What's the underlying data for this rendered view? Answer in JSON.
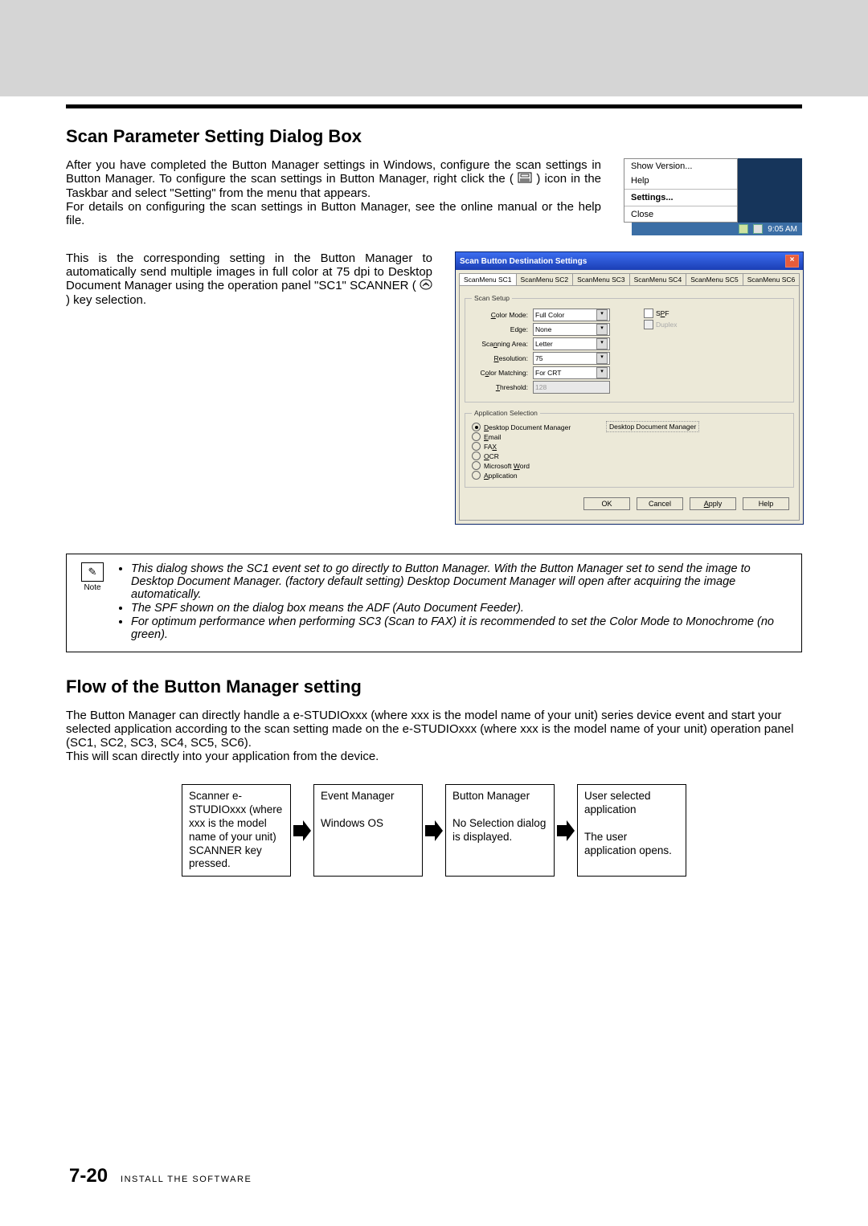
{
  "heading1": "Scan Parameter Setting Dialog Box",
  "para1a": "After you have completed the Button Manager settings in Windows, configure the scan settings in Button Manager. To configure the scan settings in Button Manager, right click the (",
  "para1b": ") icon in the Taskbar and select \"Setting\" from the menu that appears.",
  "para1c": "For details on configuring the scan settings in Button Manager, see the online manual or the help file.",
  "para2a": "This is the corresponding setting in the Button Manager to automatically send multiple images in full color at 75 dpi to Desktop Document Manager using the operation panel \"SC1\" SCANNER (",
  "para2b": ") key selection.",
  "context_menu": {
    "items": [
      "Show Version...",
      "Help",
      "Settings...",
      "Close"
    ],
    "bold_index": 2,
    "time": "9:05 AM"
  },
  "dialog": {
    "title": "Scan Button Destination Settings",
    "tabs": [
      "ScanMenu SC1",
      "ScanMenu SC2",
      "ScanMenu SC3",
      "ScanMenu SC4",
      "ScanMenu SC5",
      "ScanMenu SC6"
    ],
    "group_scan": "Scan Setup",
    "rows": {
      "color_mode": {
        "label": "Color Mode:",
        "value": "Full Color"
      },
      "edge": {
        "label": "Edge:",
        "value": "None"
      },
      "scan_area": {
        "label": "Scanning Area:",
        "value": "Letter"
      },
      "resolution": {
        "label": "Resolution:",
        "value": "75"
      },
      "color_match": {
        "label": "Color Matching:",
        "value": "For CRT"
      },
      "threshold": {
        "label": "Threshold:",
        "value": "128"
      }
    },
    "spf": "SPF",
    "duplex": "Duplex",
    "group_app": "Application Selection",
    "apps": [
      "Desktop Document Manager",
      "Email",
      "FAX",
      "OCR",
      "Microsoft Word",
      "Application"
    ],
    "app_dest_label": "Desktop Document Manager",
    "buttons": {
      "ok": "OK",
      "cancel": "Cancel",
      "apply": "Apply",
      "help": "Help"
    }
  },
  "note": {
    "label": "Note",
    "items": [
      "This dialog shows the SC1 event set to go directly to Button Manager. With the Button Manager set to send the image to Desktop Document Manager. (factory default setting) Desktop Document Manager will open after acquiring the image automatically.",
      "The SPF shown on the dialog box means the ADF (Auto Document Feeder).",
      "For optimum performance when performing SC3 (Scan to FAX) it is recommended to set the Color Mode to Monochrome (no green)."
    ]
  },
  "heading2": "Flow of the Button Manager setting",
  "para3": "The Button Manager can directly handle a e-STUDIOxxx (where xxx is the model name of your unit) series device event and start your selected application according to the scan setting made on the e-STUDIOxxx (where xxx is the model name of your unit) operation panel (SC1, SC2, SC3, SC4, SC5, SC6).\nThis will scan directly into your application from the device.",
  "flow": {
    "b1": "Scanner e-STUDIOxxx (where xxx is the model name of your unit) SCANNER key pressed.",
    "b2": "Event Manager\n\nWindows OS",
    "b3": "Button Manager\n\nNo Selection dialog is displayed.",
    "b4": "User selected application\n\nThe user application opens."
  },
  "footer": {
    "page": "7-20",
    "section": "INSTALL THE SOFTWARE"
  }
}
